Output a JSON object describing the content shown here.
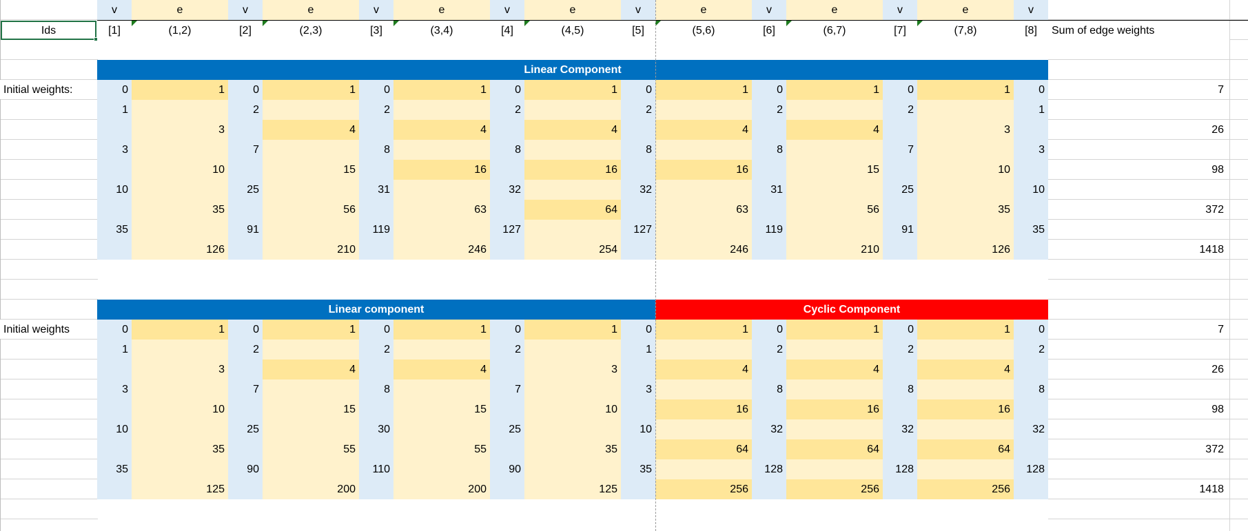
{
  "colors": {
    "v_fill": "#DDEBF7",
    "e_fill": "#FFF2CC",
    "highlight_fill": "#FFE699",
    "linear_banner": "#0070C0",
    "cyclic_banner": "#FF0000",
    "selection": "#217346"
  },
  "header": {
    "col_types": [
      "v",
      "e",
      "v",
      "e",
      "v",
      "e",
      "v",
      "e",
      "v",
      "e",
      "v",
      "e",
      "v",
      "e",
      "v"
    ],
    "ids_label": "Ids",
    "ids": [
      "[1]",
      "(1,2)",
      "[2]",
      "(2,3)",
      "[3]",
      "(3,4)",
      "[4]",
      "(4,5)",
      "[5]",
      "(5,6)",
      "[6]",
      "(6,7)",
      "[7]",
      "(7,8)",
      "[8]"
    ],
    "sum_label": "Sum of edge weights"
  },
  "tables": [
    {
      "label": "Initial weights:",
      "banners": [
        {
          "title": "Linear Component",
          "kind": "linear",
          "from": 0,
          "to": 14
        }
      ],
      "rows": [
        {
          "values": [
            "0",
            "1",
            "0",
            "1",
            "0",
            "1",
            "0",
            "1",
            "0",
            "1",
            "0",
            "1",
            "0",
            "1",
            "0"
          ],
          "sum": "7",
          "highlight": [
            1,
            3,
            5,
            7,
            9,
            11,
            13
          ]
        },
        {
          "values": [
            "1",
            "",
            "2",
            "",
            "2",
            "",
            "2",
            "",
            "2",
            "",
            "2",
            "",
            "2",
            "",
            "1"
          ],
          "sum": "",
          "highlight": []
        },
        {
          "values": [
            "",
            "3",
            "",
            "4",
            "",
            "4",
            "",
            "4",
            "",
            "4",
            "",
            "4",
            "",
            "3",
            ""
          ],
          "sum": "26",
          "highlight": [
            3,
            5,
            7,
            9,
            11
          ]
        },
        {
          "values": [
            "3",
            "",
            "7",
            "",
            "8",
            "",
            "8",
            "",
            "8",
            "",
            "8",
            "",
            "7",
            "",
            "3"
          ],
          "sum": "",
          "highlight": []
        },
        {
          "values": [
            "",
            "10",
            "",
            "15",
            "",
            "16",
            "",
            "16",
            "",
            "16",
            "",
            "15",
            "",
            "10",
            ""
          ],
          "sum": "98",
          "highlight": [
            5,
            7,
            9
          ]
        },
        {
          "values": [
            "10",
            "",
            "25",
            "",
            "31",
            "",
            "32",
            "",
            "32",
            "",
            "31",
            "",
            "25",
            "",
            "10"
          ],
          "sum": "",
          "highlight": []
        },
        {
          "values": [
            "",
            "35",
            "",
            "56",
            "",
            "63",
            "",
            "64",
            "",
            "63",
            "",
            "56",
            "",
            "35",
            ""
          ],
          "sum": "372",
          "highlight": [
            7
          ]
        },
        {
          "values": [
            "35",
            "",
            "91",
            "",
            "119",
            "",
            "127",
            "",
            "127",
            "",
            "119",
            "",
            "91",
            "",
            "35"
          ],
          "sum": "",
          "highlight": []
        },
        {
          "values": [
            "",
            "126",
            "",
            "210",
            "",
            "246",
            "",
            "254",
            "",
            "246",
            "",
            "210",
            "",
            "126",
            ""
          ],
          "sum": "1418",
          "highlight": []
        }
      ]
    },
    {
      "label": "Initial weights",
      "banners": [
        {
          "title": "Linear component",
          "kind": "linear",
          "from": 0,
          "to": 8
        },
        {
          "title": "Cyclic Component",
          "kind": "cyclic",
          "from": 9,
          "to": 14
        }
      ],
      "rows": [
        {
          "values": [
            "0",
            "1",
            "0",
            "1",
            "0",
            "1",
            "0",
            "1",
            "0",
            "1",
            "0",
            "1",
            "0",
            "1",
            "0"
          ],
          "sum": "7",
          "highlight": [
            1,
            3,
            5,
            7,
            9,
            11,
            13
          ]
        },
        {
          "values": [
            "1",
            "",
            "2",
            "",
            "2",
            "",
            "2",
            "",
            "1",
            "",
            "2",
            "",
            "2",
            "",
            "2"
          ],
          "sum": "",
          "highlight": []
        },
        {
          "values": [
            "",
            "3",
            "",
            "4",
            "",
            "4",
            "",
            "3",
            "",
            "4",
            "",
            "4",
            "",
            "4",
            ""
          ],
          "sum": "26",
          "highlight": [
            3,
            5,
            9,
            11,
            13
          ]
        },
        {
          "values": [
            "3",
            "",
            "7",
            "",
            "8",
            "",
            "7",
            "",
            "3",
            "",
            "8",
            "",
            "8",
            "",
            "8"
          ],
          "sum": "",
          "highlight": []
        },
        {
          "values": [
            "",
            "10",
            "",
            "15",
            "",
            "15",
            "",
            "10",
            "",
            "16",
            "",
            "16",
            "",
            "16",
            ""
          ],
          "sum": "98",
          "highlight": [
            9,
            11,
            13
          ]
        },
        {
          "values": [
            "10",
            "",
            "25",
            "",
            "30",
            "",
            "25",
            "",
            "10",
            "",
            "32",
            "",
            "32",
            "",
            "32"
          ],
          "sum": "",
          "highlight": []
        },
        {
          "values": [
            "",
            "35",
            "",
            "55",
            "",
            "55",
            "",
            "35",
            "",
            "64",
            "",
            "64",
            "",
            "64",
            ""
          ],
          "sum": "372",
          "highlight": [
            9,
            11,
            13
          ]
        },
        {
          "values": [
            "35",
            "",
            "90",
            "",
            "110",
            "",
            "90",
            "",
            "35",
            "",
            "128",
            "",
            "128",
            "",
            "128"
          ],
          "sum": "",
          "highlight": []
        },
        {
          "values": [
            "",
            "125",
            "",
            "200",
            "",
            "200",
            "",
            "125",
            "",
            "256",
            "",
            "256",
            "",
            "256",
            ""
          ],
          "sum": "1418",
          "highlight": [
            9,
            11,
            13
          ]
        }
      ]
    }
  ]
}
